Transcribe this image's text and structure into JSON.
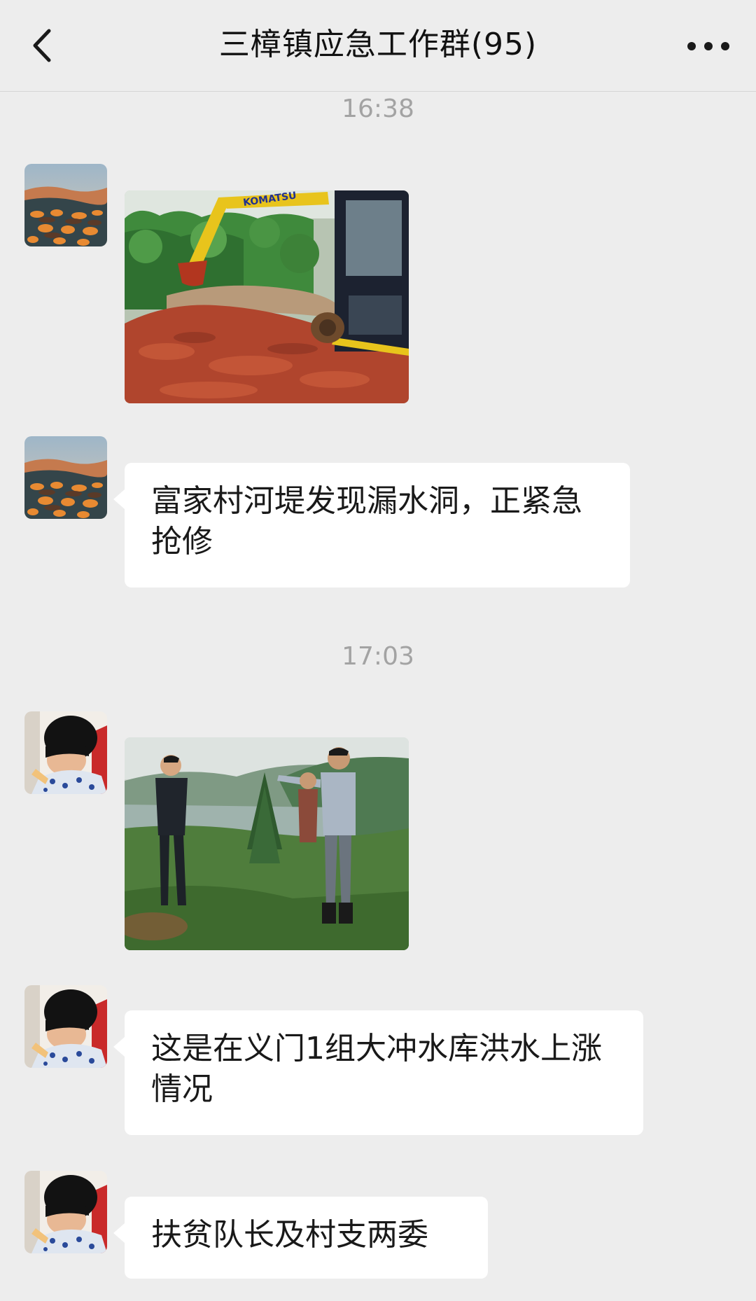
{
  "header": {
    "title": "三樟镇应急工作群(95)",
    "back_icon": "chevron-left-icon",
    "more_icon": "more-dots-icon"
  },
  "messages": [
    {
      "type": "time",
      "text": "16:38"
    },
    {
      "type": "image",
      "sender_avatar": "landscape-avatar",
      "image": "excavator-photo",
      "brand_text": "KOMATSU"
    },
    {
      "type": "text",
      "sender_avatar": "landscape-avatar",
      "text": "富家村河堤发现漏水洞，正紧急抢修"
    },
    {
      "type": "time",
      "text": "17:03"
    },
    {
      "type": "image",
      "sender_avatar": "child-avatar",
      "image": "reservoir-inspection-photo"
    },
    {
      "type": "text",
      "sender_avatar": "child-avatar",
      "text": "这是在义门1组大冲水库洪水上涨情况"
    },
    {
      "type": "text",
      "sender_avatar": "child-avatar",
      "text": "扶贫队长及村支两委"
    }
  ],
  "colors": {
    "background": "#ededed",
    "bubble": "#ffffff",
    "timestamp": "#a3a3a3",
    "text": "#191919"
  }
}
